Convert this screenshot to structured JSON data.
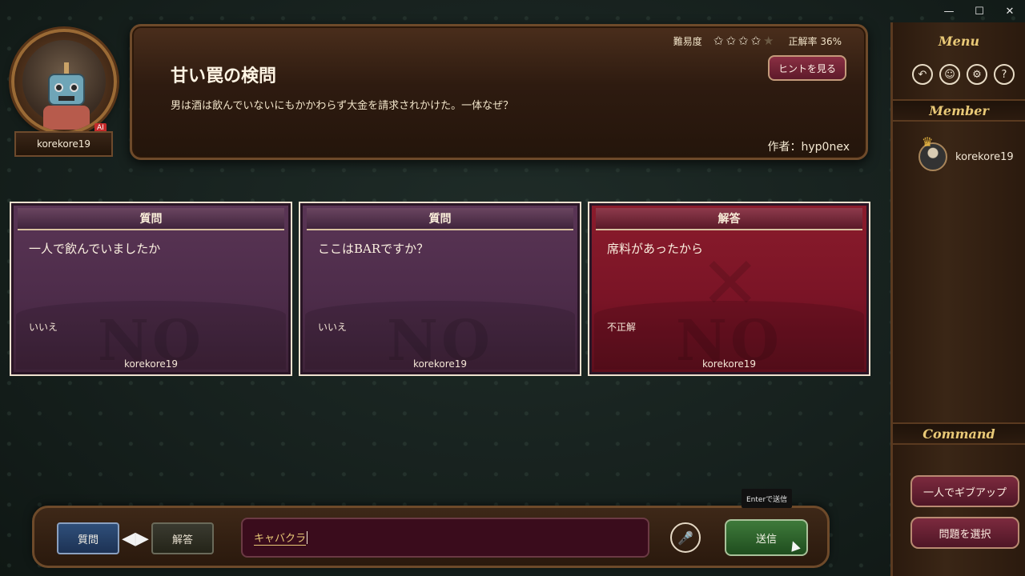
{
  "window_controls": {
    "minimize": "—",
    "maximize": "☐",
    "close": "✕"
  },
  "player": {
    "name": "korekore19",
    "badge": "AI"
  },
  "puzzle": {
    "title": "甘い罠の検問",
    "question": "男は酒は飲んでいないにもかかわらず大金を請求されかけた。一体なぜ？",
    "author": "作者：hyp0nex",
    "difficulty_label": "難易度",
    "difficulty_stars": 4,
    "difficulty_max": 5,
    "rate_label": "正解率 36%",
    "hint_button": "ヒントを見る"
  },
  "cards": [
    {
      "type": "question",
      "header": "質問",
      "text": "一人で飲んでいましたか",
      "verdict": "いいえ",
      "watermark": "NO",
      "user": "korekore19"
    },
    {
      "type": "question",
      "header": "質問",
      "text": "ここはBARですか？",
      "verdict": "いいえ",
      "watermark": "NO",
      "user": "korekore19"
    },
    {
      "type": "answer",
      "header": "解答",
      "text": "席料があったから",
      "verdict": "不正解",
      "watermark": "NO",
      "user": "korekore19"
    }
  ],
  "sidebar": {
    "menu_title": "Menu",
    "menu_icons": [
      "back-icon",
      "discord-icon",
      "gear-icon",
      "help-icon"
    ],
    "member_title": "Member",
    "members": [
      {
        "name": "korekore19",
        "host": true
      }
    ],
    "command_title": "Command",
    "commands": [
      "一人でギブアップ",
      "問題を選択"
    ]
  },
  "input_bar": {
    "mode_question": "質問",
    "mode_answer": "解答",
    "active_mode": "question",
    "value": "キャバクラ",
    "send_button": "送信",
    "send_tooltip": "Enterで送信"
  },
  "colors": {
    "accent_gold": "#e9c977",
    "question_card": "#5a3555",
    "answer_card": "#8b1c2c",
    "send_green": "#3e7a3a"
  }
}
